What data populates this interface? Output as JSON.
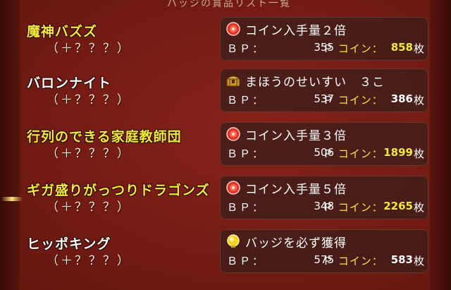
{
  "header": {
    "title": "バッジの賞品リスト一覧"
  },
  "labels": {
    "bp_label": "ＢＰ：",
    "point_unit": "Ｐ",
    "coin_label": "コイン：",
    "coin_unit": "枚"
  },
  "rows": [
    {
      "name": "魔神バズズ",
      "name_color": "yellow",
      "sub": "（＋？？？）",
      "reward_icon": "coin-medal-icon",
      "reward": "コイン入手量２倍",
      "bp": "355",
      "coins": "858",
      "coin_color": "yellow"
    },
    {
      "name": "バロンナイト",
      "name_color": "white",
      "sub": "（＋？？？）",
      "reward_icon": "treasure-chest-icon",
      "reward": "まほうのせいすい　３こ",
      "bp": "537",
      "coins": "386",
      "coin_color": "white"
    },
    {
      "name": "行列のできる家庭教師団",
      "name_color": "yellow",
      "sub": "（＋？？？）",
      "reward_icon": "coin-medal-icon",
      "reward": "コイン入手量３倍",
      "bp": "506",
      "coins": "1899",
      "coin_color": "yellow"
    },
    {
      "name": "ギガ盛りがっつりドラゴンズ",
      "name_color": "yellow",
      "sub": "（＋？？？）",
      "reward_icon": "coin-medal-icon",
      "reward": "コイン入手量５倍",
      "bp": "348",
      "coins": "2265",
      "coin_color": "yellow"
    },
    {
      "name": "ヒッポキング",
      "name_color": "white",
      "sub": "（＋？？？）",
      "reward_icon": "badge-icon",
      "reward": "バッジを必ず獲得",
      "bp": "575",
      "coins": "583",
      "coin_color": "white"
    }
  ]
}
